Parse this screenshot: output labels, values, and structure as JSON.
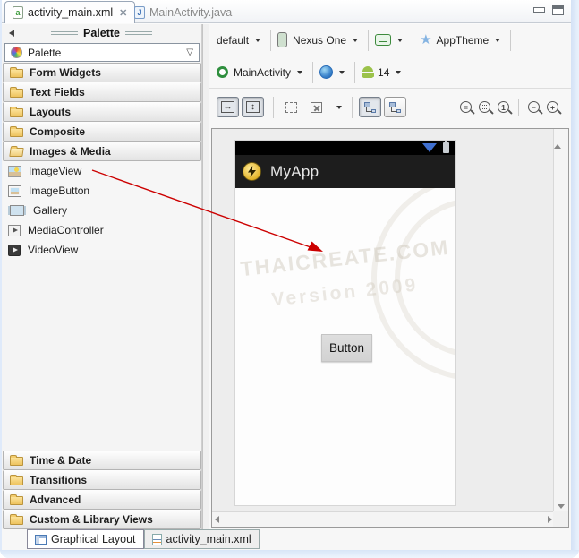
{
  "top_tabs": {
    "active": "activity_main.xml",
    "inactive": "MainActivity.java",
    "close_glyph": "✕"
  },
  "palette": {
    "panel_title": "Palette",
    "combo_label": "Palette",
    "categories_top": [
      "Form Widgets",
      "Text Fields",
      "Layouts",
      "Composite"
    ],
    "open_category": "Images & Media",
    "items": [
      "ImageView",
      "ImageButton",
      "Gallery",
      "MediaController",
      "VideoView"
    ],
    "categories_bottom": [
      "Time & Date",
      "Transitions",
      "Advanced",
      "Custom & Library Views"
    ]
  },
  "toolbar": {
    "config": "default",
    "device": "Nexus One",
    "theme": "AppTheme",
    "activity": "MainActivity",
    "api_level": "14",
    "zoom_fit_glyph": "=",
    "zoom_100_glyph": "1",
    "zoom_out_glyph": "−",
    "zoom_in_glyph": "+"
  },
  "device_screen": {
    "app_title": "MyApp",
    "button_label": "Button",
    "watermark_line1": "THAICREATE.COM",
    "watermark_line2": "Version 2009"
  },
  "bottom_tabs": {
    "graphical_layout": "Graphical Layout",
    "xml": "activity_main.xml"
  },
  "colors": {
    "annotation_arrow": "#cc0000",
    "actionbar_bg": "#1d1d1d",
    "android_green": "#9bc24a",
    "theme_star_blue": "#85b4e2",
    "signal_blue": "#3f6fd0"
  }
}
